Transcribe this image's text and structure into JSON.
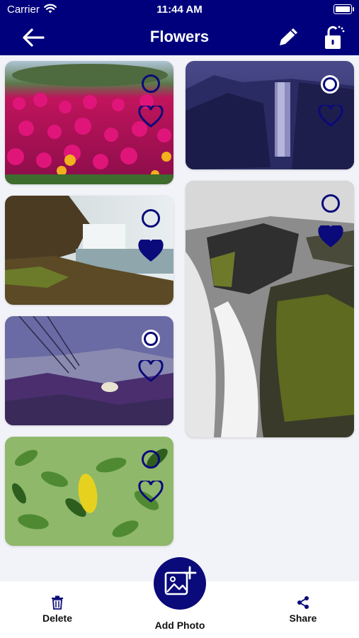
{
  "status_bar": {
    "carrier": "Carrier",
    "time": "11:44 AM"
  },
  "nav": {
    "title": "Flowers"
  },
  "photos": [
    {
      "subject": "pink ice plant flowers",
      "selected": false,
      "favorite": false
    },
    {
      "subject": "waterfall over cliff at dusk",
      "selected": true,
      "favorite": false
    },
    {
      "subject": "waterfall and rocky shore",
      "selected": false,
      "favorite": true
    },
    {
      "subject": "long-exposure waterfall over mossy rocks",
      "selected": false,
      "favorite": true
    },
    {
      "subject": "coastal hillside with purple plants",
      "selected": true,
      "favorite": false
    },
    {
      "subject": "green leaves with yellow leaf",
      "selected": false,
      "favorite": false
    }
  ],
  "toolbar": {
    "delete_label": "Delete",
    "add_label": "Add Photo",
    "share_label": "Share"
  },
  "colors": {
    "nav_bg": "#00007d",
    "accent": "#0a0a7a",
    "background": "#f2f3f8"
  }
}
